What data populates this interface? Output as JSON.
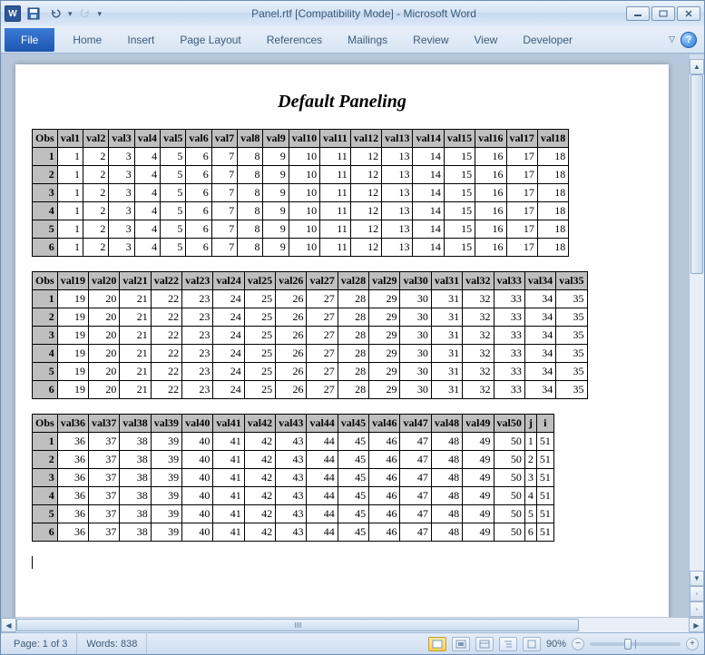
{
  "titlebar": {
    "doc_title": "Panel.rtf [Compatibility Mode]  -  Microsoft Word",
    "word_glyph": "W"
  },
  "ribbon": {
    "file": "File",
    "tabs": [
      "Home",
      "Insert",
      "Page Layout",
      "References",
      "Mailings",
      "Review",
      "View",
      "Developer"
    ],
    "help_glyph": "?"
  },
  "doc": {
    "title": "Default Paneling",
    "panels": [
      {
        "headers": [
          "Obs",
          "val1",
          "val2",
          "val3",
          "val4",
          "val5",
          "val6",
          "val7",
          "val8",
          "val9",
          "val10",
          "val11",
          "val12",
          "val13",
          "val14",
          "val15",
          "val16",
          "val17",
          "val18"
        ],
        "rows": [
          [
            "1",
            1,
            2,
            3,
            4,
            5,
            6,
            7,
            8,
            9,
            10,
            11,
            12,
            13,
            14,
            15,
            16,
            17,
            18
          ],
          [
            "2",
            1,
            2,
            3,
            4,
            5,
            6,
            7,
            8,
            9,
            10,
            11,
            12,
            13,
            14,
            15,
            16,
            17,
            18
          ],
          [
            "3",
            1,
            2,
            3,
            4,
            5,
            6,
            7,
            8,
            9,
            10,
            11,
            12,
            13,
            14,
            15,
            16,
            17,
            18
          ],
          [
            "4",
            1,
            2,
            3,
            4,
            5,
            6,
            7,
            8,
            9,
            10,
            11,
            12,
            13,
            14,
            15,
            16,
            17,
            18
          ],
          [
            "5",
            1,
            2,
            3,
            4,
            5,
            6,
            7,
            8,
            9,
            10,
            11,
            12,
            13,
            14,
            15,
            16,
            17,
            18
          ],
          [
            "6",
            1,
            2,
            3,
            4,
            5,
            6,
            7,
            8,
            9,
            10,
            11,
            12,
            13,
            14,
            15,
            16,
            17,
            18
          ]
        ]
      },
      {
        "headers": [
          "Obs",
          "val19",
          "val20",
          "val21",
          "val22",
          "val23",
          "val24",
          "val25",
          "val26",
          "val27",
          "val28",
          "val29",
          "val30",
          "val31",
          "val32",
          "val33",
          "val34",
          "val35"
        ],
        "rows": [
          [
            "1",
            19,
            20,
            21,
            22,
            23,
            24,
            25,
            26,
            27,
            28,
            29,
            30,
            31,
            32,
            33,
            34,
            35
          ],
          [
            "2",
            19,
            20,
            21,
            22,
            23,
            24,
            25,
            26,
            27,
            28,
            29,
            30,
            31,
            32,
            33,
            34,
            35
          ],
          [
            "3",
            19,
            20,
            21,
            22,
            23,
            24,
            25,
            26,
            27,
            28,
            29,
            30,
            31,
            32,
            33,
            34,
            35
          ],
          [
            "4",
            19,
            20,
            21,
            22,
            23,
            24,
            25,
            26,
            27,
            28,
            29,
            30,
            31,
            32,
            33,
            34,
            35
          ],
          [
            "5",
            19,
            20,
            21,
            22,
            23,
            24,
            25,
            26,
            27,
            28,
            29,
            30,
            31,
            32,
            33,
            34,
            35
          ],
          [
            "6",
            19,
            20,
            21,
            22,
            23,
            24,
            25,
            26,
            27,
            28,
            29,
            30,
            31,
            32,
            33,
            34,
            35
          ]
        ]
      },
      {
        "headers": [
          "Obs",
          "val36",
          "val37",
          "val38",
          "val39",
          "val40",
          "val41",
          "val42",
          "val43",
          "val44",
          "val45",
          "val46",
          "val47",
          "val48",
          "val49",
          "val50",
          "j",
          "i"
        ],
        "rows": [
          [
            "1",
            36,
            37,
            38,
            39,
            40,
            41,
            42,
            43,
            44,
            45,
            46,
            47,
            48,
            49,
            50,
            1,
            51
          ],
          [
            "2",
            36,
            37,
            38,
            39,
            40,
            41,
            42,
            43,
            44,
            45,
            46,
            47,
            48,
            49,
            50,
            2,
            51
          ],
          [
            "3",
            36,
            37,
            38,
            39,
            40,
            41,
            42,
            43,
            44,
            45,
            46,
            47,
            48,
            49,
            50,
            3,
            51
          ],
          [
            "4",
            36,
            37,
            38,
            39,
            40,
            41,
            42,
            43,
            44,
            45,
            46,
            47,
            48,
            49,
            50,
            4,
            51
          ],
          [
            "5",
            36,
            37,
            38,
            39,
            40,
            41,
            42,
            43,
            44,
            45,
            46,
            47,
            48,
            49,
            50,
            5,
            51
          ],
          [
            "6",
            36,
            37,
            38,
            39,
            40,
            41,
            42,
            43,
            44,
            45,
            46,
            47,
            48,
            49,
            50,
            6,
            51
          ]
        ]
      }
    ]
  },
  "status": {
    "page": "Page: 1 of 3",
    "words": "Words: 838",
    "zoom": "90%",
    "minus": "−",
    "plus": "+"
  }
}
